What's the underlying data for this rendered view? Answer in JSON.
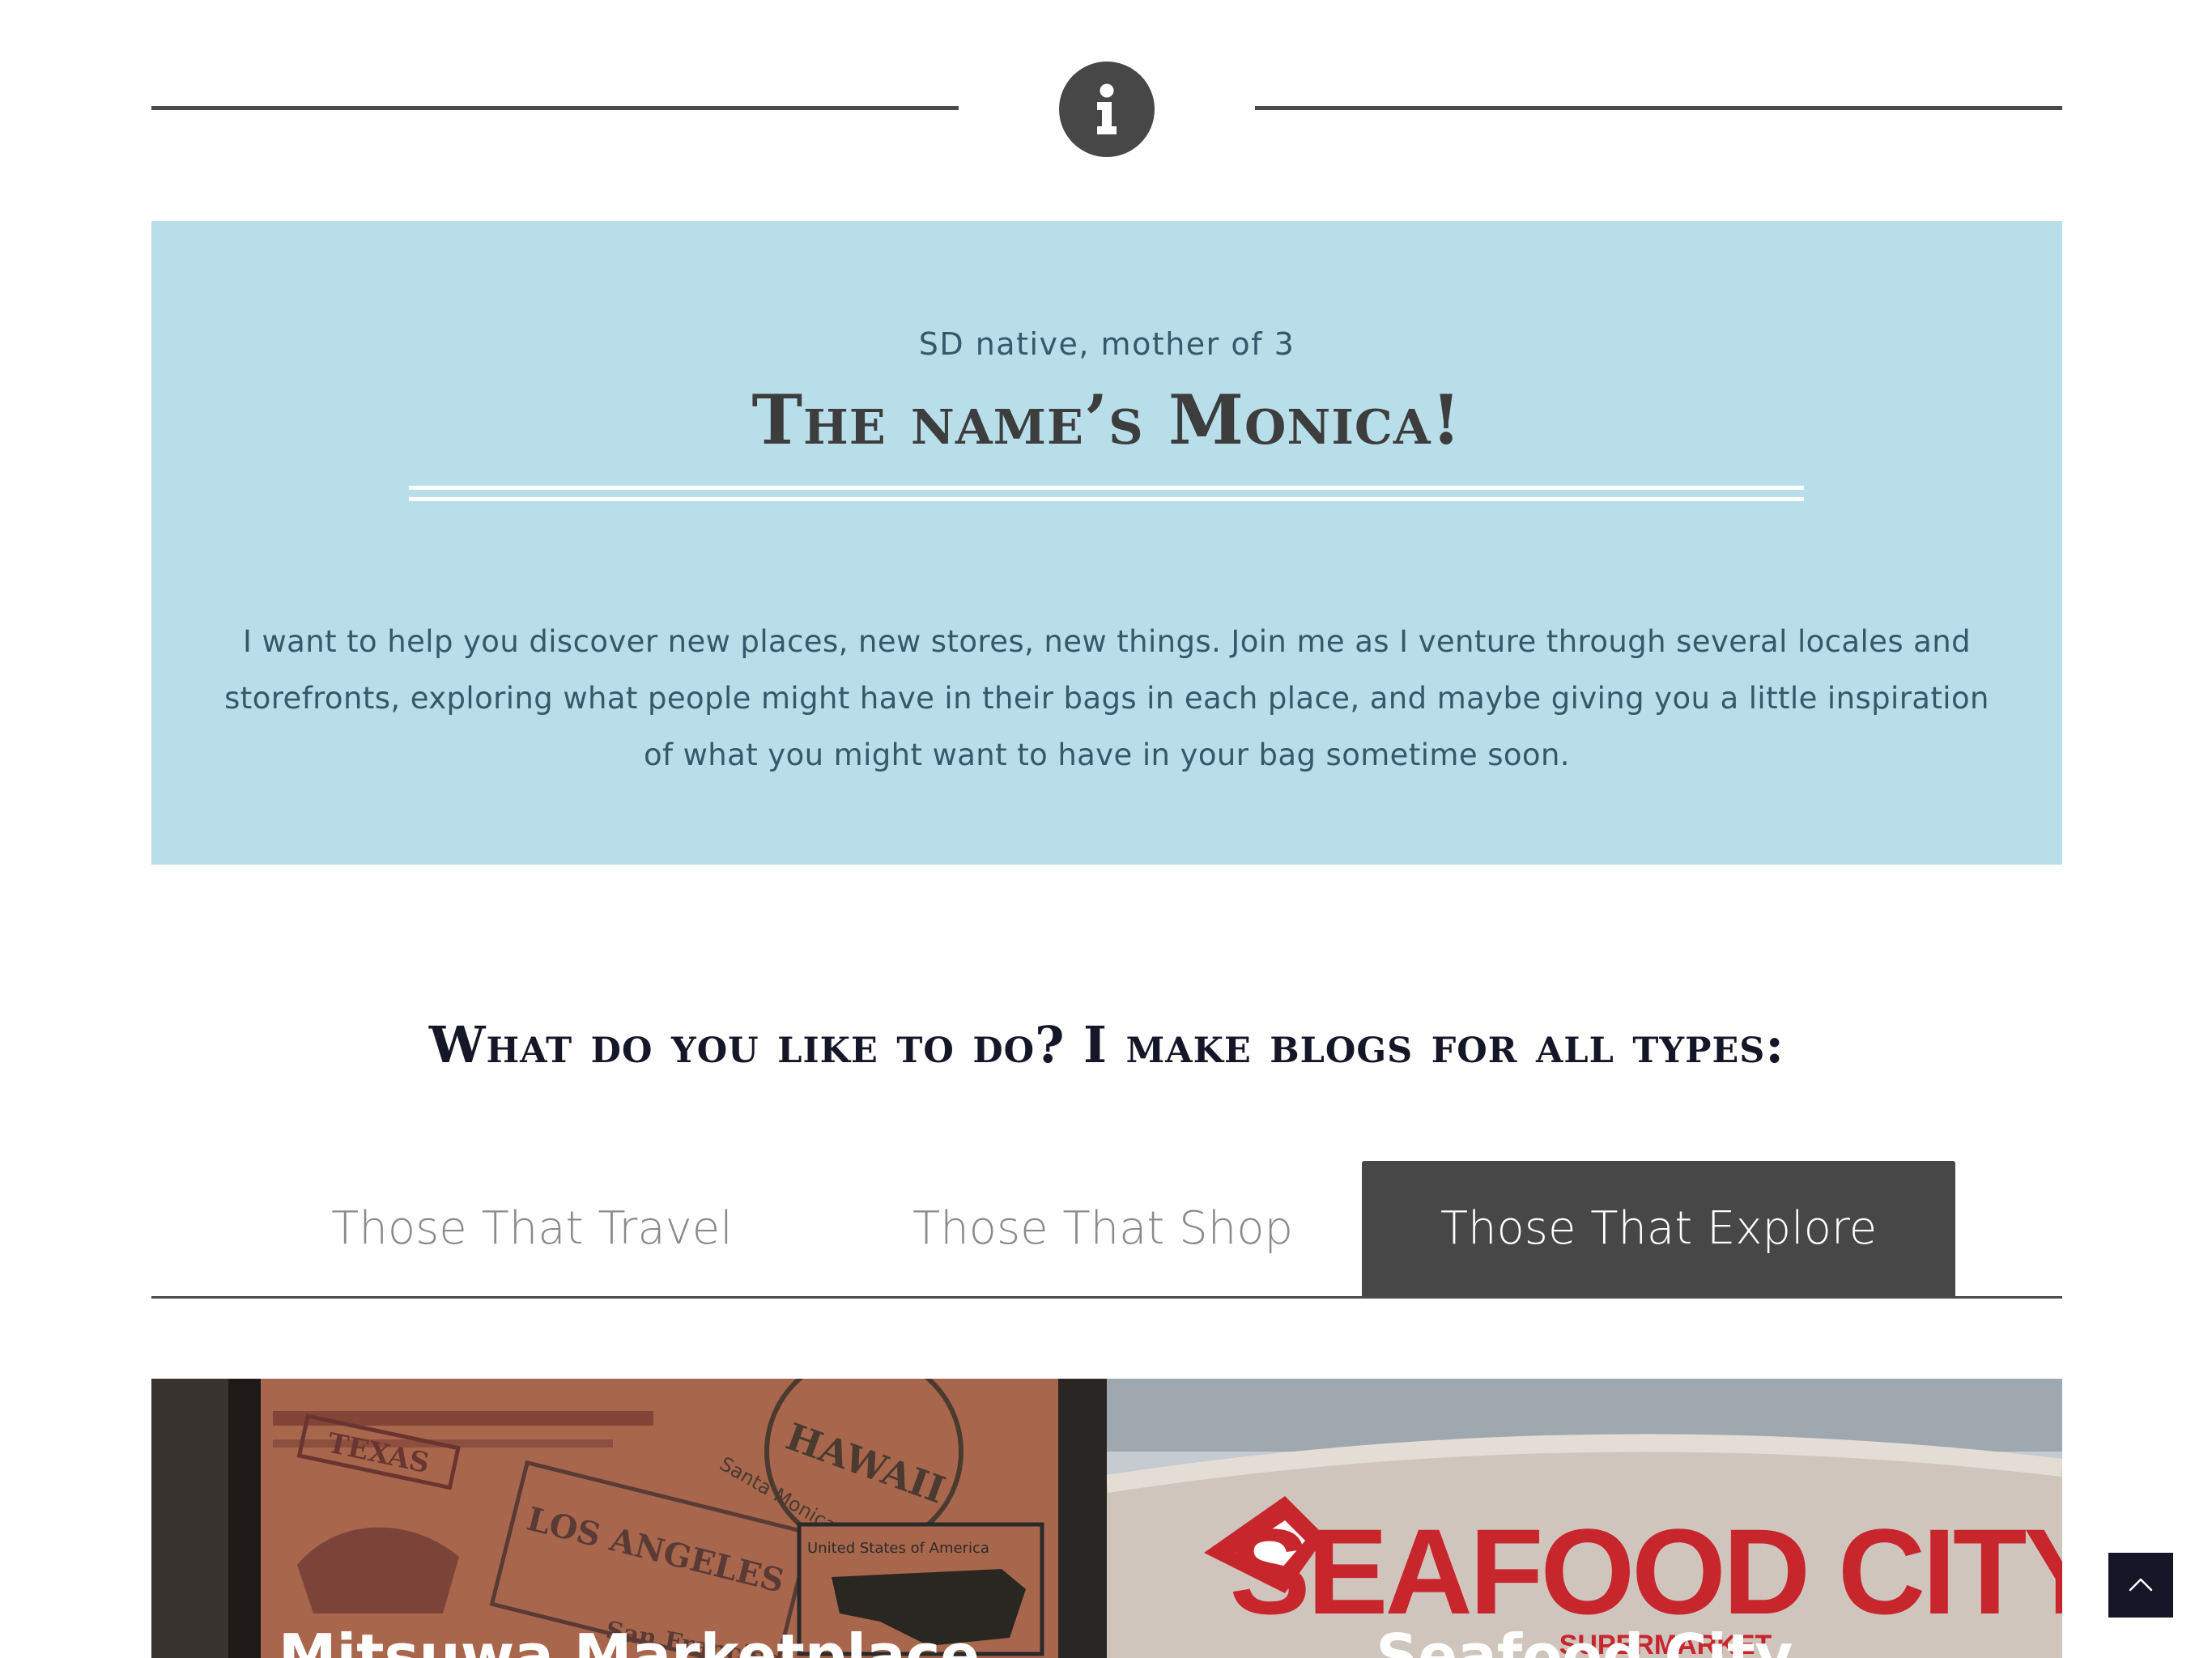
{
  "divider": {
    "icon": "info-icon"
  },
  "about": {
    "eyebrow": "SD native, mother of 3",
    "title": "The name’s Monica!",
    "description": "I want to help you discover new places, new stores, new things. Join me as I venture through several locales and storefronts, exploring what people might have in their bags in each place, and maybe giving you a little inspiration of what you might want to have in your bag sometime soon.",
    "background_color": "#b8dfe9"
  },
  "section": {
    "heading": "What do you like to do? I make blogs for all types:"
  },
  "tabs": [
    {
      "label": "Those That Travel",
      "active": false
    },
    {
      "label": "Those That Shop",
      "active": false
    },
    {
      "label": "Those That Explore",
      "active": true
    }
  ],
  "cards": [
    {
      "title": "Mitsuwa Marketplace",
      "image_text": [
        "TEXAS",
        "LOS ANGELES",
        "HAWAII",
        "Santa Monica",
        "United States of America",
        "San Francisco"
      ]
    },
    {
      "title": "Seafood City",
      "image_text": [
        "SEAFOOD CITY",
        "SUPERMARKET"
      ]
    }
  ],
  "back_to_top": {
    "icon": "chevron-up-icon"
  },
  "colors": {
    "dark": "#474747",
    "navy": "#161629",
    "panel": "#b8dfe9"
  }
}
